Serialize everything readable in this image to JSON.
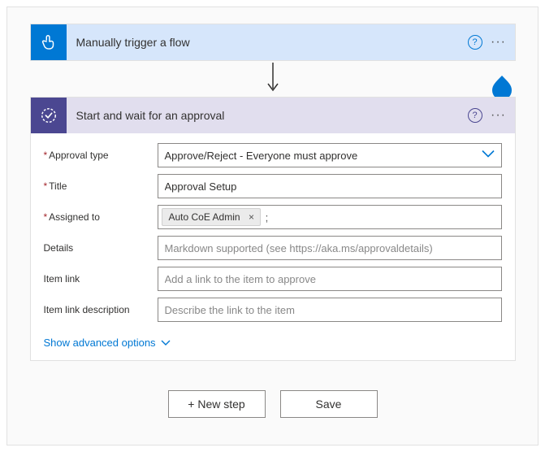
{
  "trigger": {
    "title": "Manually trigger a flow",
    "icon": "touch-icon"
  },
  "approval": {
    "title": "Start and wait for an approval",
    "icon": "approval-check-icon",
    "fields": {
      "approval_type": {
        "label": "Approval type",
        "value": "Approve/Reject - Everyone must approve"
      },
      "title": {
        "label": "Title",
        "value": "Approval Setup"
      },
      "assigned_to": {
        "label": "Assigned to",
        "chip": "Auto CoE Admin"
      },
      "details": {
        "label": "Details",
        "placeholder": "Markdown supported (see https://aka.ms/approvaldetails)"
      },
      "item_link": {
        "label": "Item link",
        "placeholder": "Add a link to the item to approve"
      },
      "item_link_desc": {
        "label": "Item link description",
        "placeholder": "Describe the link to the item"
      }
    },
    "advanced": "Show advanced options"
  },
  "footer": {
    "new_step": "+ New step",
    "save": "Save"
  }
}
